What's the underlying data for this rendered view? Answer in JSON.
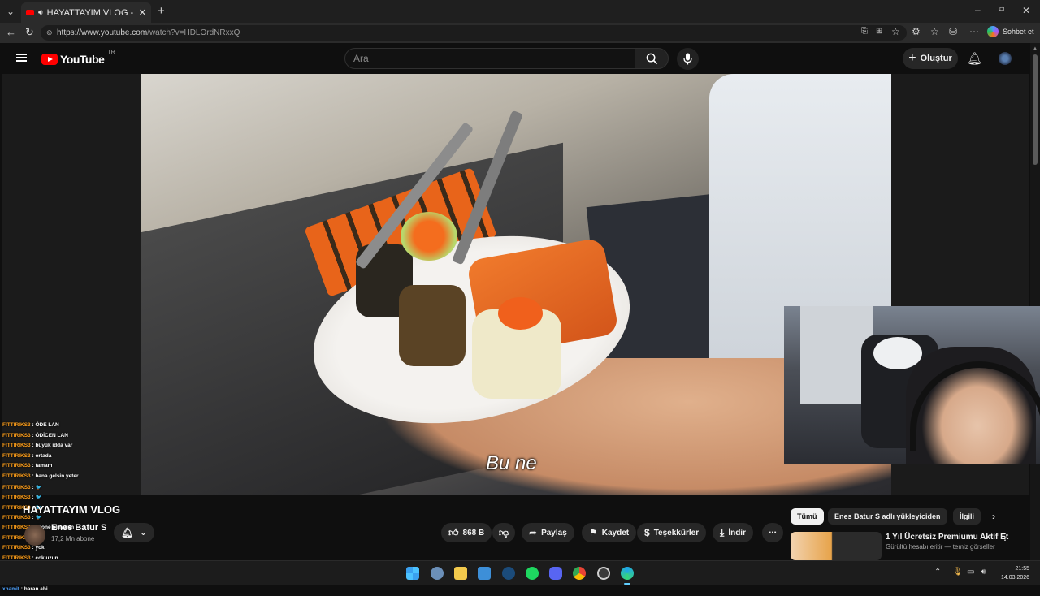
{
  "browser": {
    "tab_title": "HAYATTAYIM VLOG - YouTube",
    "url_host": "https://www.youtube.com",
    "url_path": "/watch?v=HDLOrdNRxxQ",
    "copilot_label": "Sohbet et"
  },
  "youtube": {
    "logo_text": "YouTube",
    "region": "TR",
    "search_placeholder": "Ara",
    "create_label": "Oluştur"
  },
  "video": {
    "caption": "Bu ne",
    "title": "HAYATTAYIM VLOG",
    "channel": "Enes Batur S",
    "subscribers": "17,2 Mn abone",
    "actions": {
      "like_count": "868 B",
      "share": "Paylaş",
      "save": "Kaydet",
      "thanks": "Teşekkürler",
      "download": "İndir"
    }
  },
  "chat": [
    {
      "user": "FITTIRIKS3",
      "msg": "ÖDE LAN"
    },
    {
      "user": "FITTIRIKS3",
      "msg": "ÖDİCEN LAN"
    },
    {
      "user": "FITTIRIKS3",
      "msg": "büyük idda var"
    },
    {
      "user": "FITTIRIKS3",
      "msg": "ortada"
    },
    {
      "user": "FITTIRIKS3",
      "msg": "tamam"
    },
    {
      "user": "FITTIRIKS3",
      "msg": "bana gelsin yeter"
    },
    {
      "user": "FITTIRIKS3",
      "msg": "🐦"
    },
    {
      "user": "FITTIRIKS3",
      "msg": "🐦"
    },
    {
      "user": "FITTIRIKS3",
      "msg": "🐦"
    },
    {
      "user": "FITTIRIKS3",
      "msg": "🐦"
    },
    {
      "user": "FITTIRIKS3",
      "msg": "abone olmadan"
    },
    {
      "user": "FITTIRIKS3",
      "msg": "siz"
    },
    {
      "user": "FITTIRIKS3",
      "msg": "yok"
    },
    {
      "user": "FITTIRIKS3",
      "msg": "çok uzun"
    },
    {
      "user": "Mirac",
      "msg": "GAL - BAS"
    },
    {
      "user": "Mirac",
      "msg": "Canlı - H2"
    },
    {
      "user": "xhamit",
      "msg": "baran abi"
    }
  ],
  "sidebar": {
    "chips": [
      "Tümü",
      "Enes Batur S adlı yükleyiciden",
      "İlgili"
    ],
    "recommend_title": "1 Yıl Ücretsiz Premiumu Aktif Et",
    "recommend_desc": "Gürültü hesabı eritir — temiz görseller"
  },
  "taskbar": {
    "time": "21:55",
    "date": "14.03.2026"
  }
}
